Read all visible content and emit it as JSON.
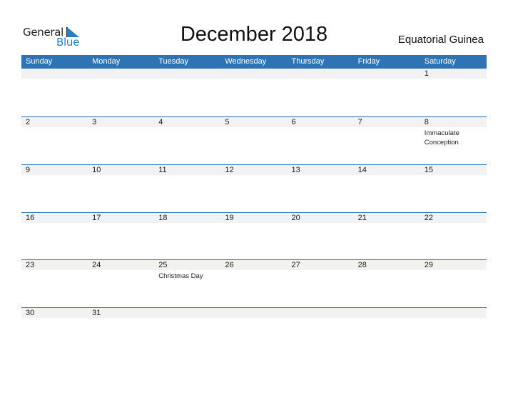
{
  "logo": {
    "word1": "General",
    "word2": "Blue"
  },
  "title": "December 2018",
  "country": "Equatorial Guinea",
  "colors": {
    "accent": "#2e74b5",
    "row_bg": "#f2f2f2"
  },
  "weekdays": [
    "Sunday",
    "Monday",
    "Tuesday",
    "Wednesday",
    "Thursday",
    "Friday",
    "Saturday"
  ],
  "weeks": [
    {
      "days": [
        {
          "n": ""
        },
        {
          "n": ""
        },
        {
          "n": ""
        },
        {
          "n": ""
        },
        {
          "n": ""
        },
        {
          "n": ""
        },
        {
          "n": "1"
        }
      ]
    },
    {
      "days": [
        {
          "n": "2"
        },
        {
          "n": "3"
        },
        {
          "n": "4"
        },
        {
          "n": "5"
        },
        {
          "n": "6"
        },
        {
          "n": "7"
        },
        {
          "n": "8",
          "holiday": "Immaculate Conception"
        }
      ]
    },
    {
      "days": [
        {
          "n": "9"
        },
        {
          "n": "10"
        },
        {
          "n": "11"
        },
        {
          "n": "12"
        },
        {
          "n": "13"
        },
        {
          "n": "14"
        },
        {
          "n": "15"
        }
      ]
    },
    {
      "days": [
        {
          "n": "16"
        },
        {
          "n": "17"
        },
        {
          "n": "18"
        },
        {
          "n": "19"
        },
        {
          "n": "20"
        },
        {
          "n": "21"
        },
        {
          "n": "22"
        }
      ]
    },
    {
      "days": [
        {
          "n": "23"
        },
        {
          "n": "24"
        },
        {
          "n": "25",
          "holiday": "Christmas Day"
        },
        {
          "n": "26"
        },
        {
          "n": "27"
        },
        {
          "n": "28"
        },
        {
          "n": "29"
        }
      ]
    },
    {
      "days": [
        {
          "n": "30"
        },
        {
          "n": "31"
        },
        {
          "n": ""
        },
        {
          "n": ""
        },
        {
          "n": ""
        },
        {
          "n": ""
        },
        {
          "n": ""
        }
      ]
    }
  ]
}
